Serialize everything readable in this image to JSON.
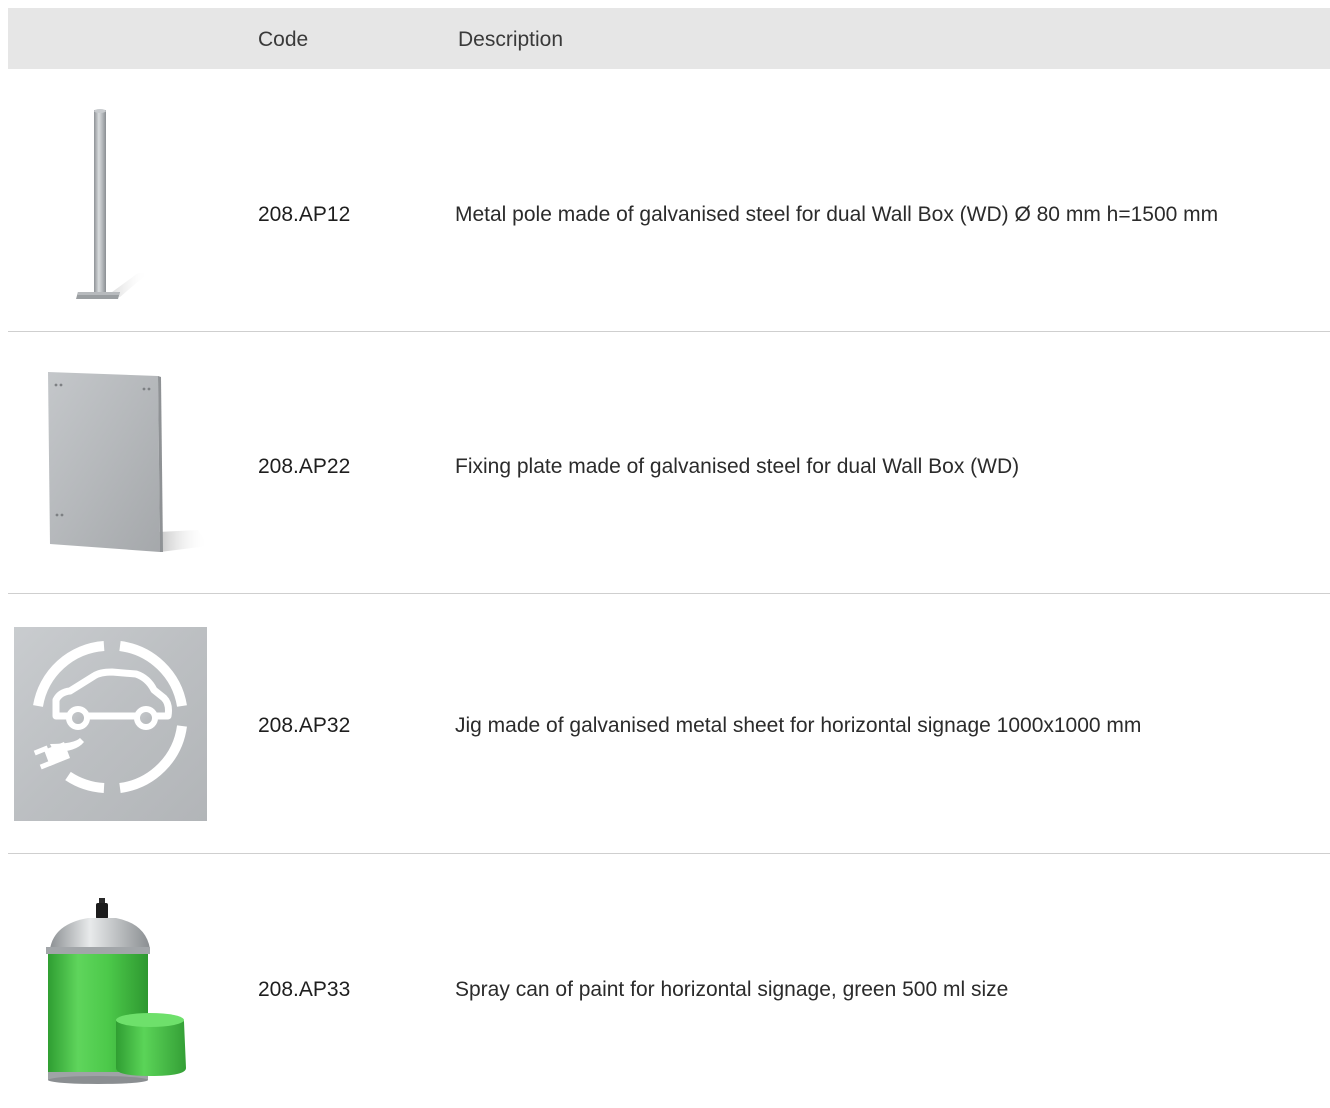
{
  "header": {
    "code_label": "Code",
    "description_label": "Description"
  },
  "rows": [
    {
      "code": "208.AP12",
      "description": "Metal pole made of galvanised steel for dual Wall Box (WD) Ø 80 mm h=1500 mm",
      "image": "metal-pole-image"
    },
    {
      "code": "208.AP22",
      "description": "Fixing plate made of galvanised steel for dual Wall Box (WD)",
      "image": "fixing-plate-image"
    },
    {
      "code": "208.AP32",
      "description": "Jig made of galvanised metal sheet for horizontal signage 1000x1000 mm",
      "image": "signage-jig-image"
    },
    {
      "code": "208.AP33",
      "description": "Spray can of paint for horizontal signage, green 500 ml size",
      "image": "spray-can-image"
    }
  ],
  "colors": {
    "header_bg": "#e6e6e6",
    "divider": "#cfcfcf",
    "metal": "#b9bcbf",
    "paint_green": "#4cc94a"
  }
}
